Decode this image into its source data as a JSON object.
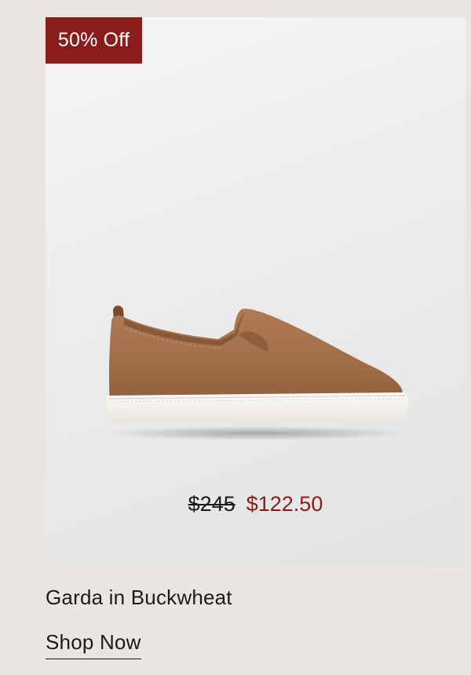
{
  "product": {
    "badge_text": "50% Off",
    "original_price": "$245",
    "sale_price": "$122.50",
    "name": "Garda in Buckwheat",
    "cta_label": "Shop Now",
    "image_name": "slip-on-sneaker-buckwheat"
  },
  "colors": {
    "badge_bg": "#8a1c1c",
    "sale_price": "#8a1c1c",
    "page_bg": "#e9e6e2",
    "text": "#1b1b1b",
    "shoe_upper": "#a06e48",
    "shoe_sole": "#f5f3ee"
  }
}
